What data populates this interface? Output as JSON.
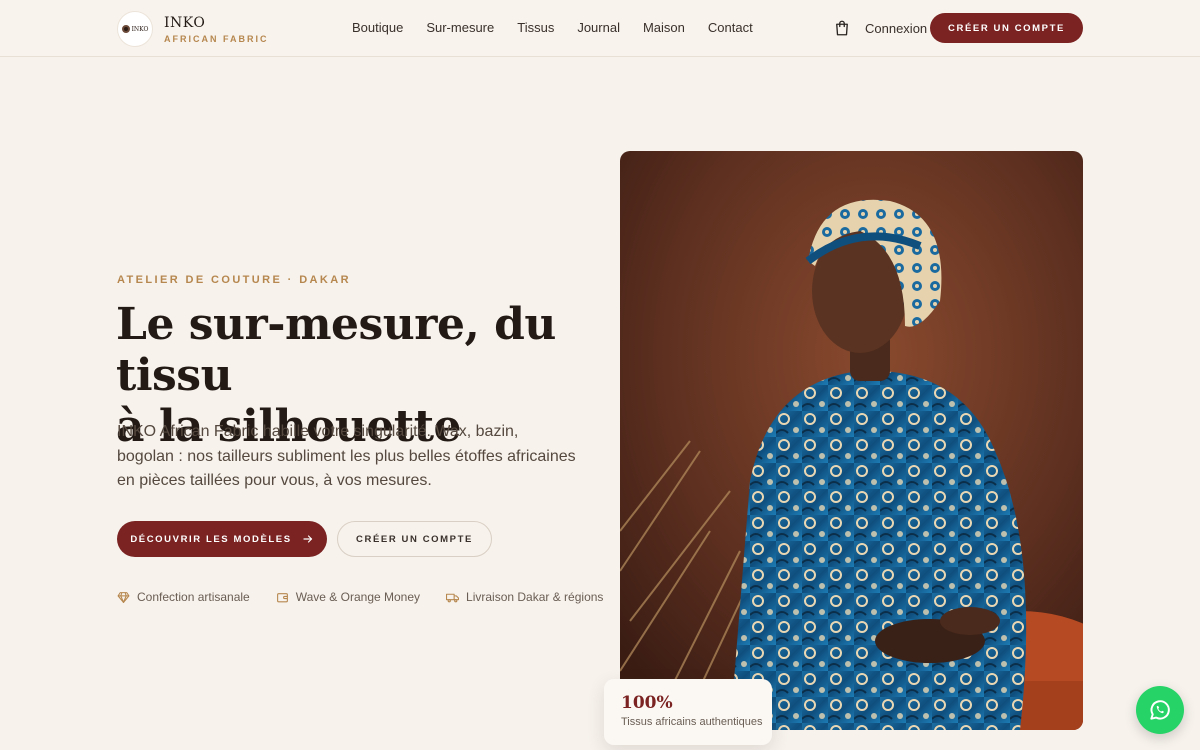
{
  "brand": {
    "badge_text": "INKO",
    "name": "INKO",
    "tagline": "AFRICAN FABRIC"
  },
  "nav": {
    "items": [
      {
        "label": "Boutique"
      },
      {
        "label": "Sur-mesure"
      },
      {
        "label": "Tissus"
      },
      {
        "label": "Journal"
      },
      {
        "label": "Maison"
      },
      {
        "label": "Contact"
      }
    ],
    "cart_icon": "shopping-bag-icon",
    "login_label": "Connexion",
    "signup_label": "CRÉER UN COMPTE"
  },
  "hero": {
    "eyebrow": "ATELIER DE COUTURE · DAKAR",
    "title_line1": "Le sur-mesure, du tissu",
    "title_line2": "à la silhouette",
    "body": "INKO African Fabric habille votre singularité. Wax, bazin, bogolan : nos tailleurs subliment les plus belles étoffes africaines en pièces taillées pour vous, à vos mesures.",
    "primary_cta": "DÉCOUVRIR LES MODÈLES",
    "primary_cta_icon": "arrow-right-icon",
    "secondary_cta": "CRÉER UN COMPTE",
    "features": [
      {
        "icon": "diamond-icon",
        "label": "Confection artisanale"
      },
      {
        "icon": "wallet-icon",
        "label": "Wave & Orange Money"
      },
      {
        "icon": "truck-icon",
        "label": "Livraison Dakar & régions"
      }
    ]
  },
  "stat": {
    "value": "100%",
    "label": "Tissus africains authentiques"
  },
  "floating": {
    "icon": "whatsapp-icon"
  },
  "colors": {
    "background": "#f7f2ec",
    "accent": "#7a2322",
    "gold": "#b6874e",
    "whatsapp": "#25d366"
  }
}
